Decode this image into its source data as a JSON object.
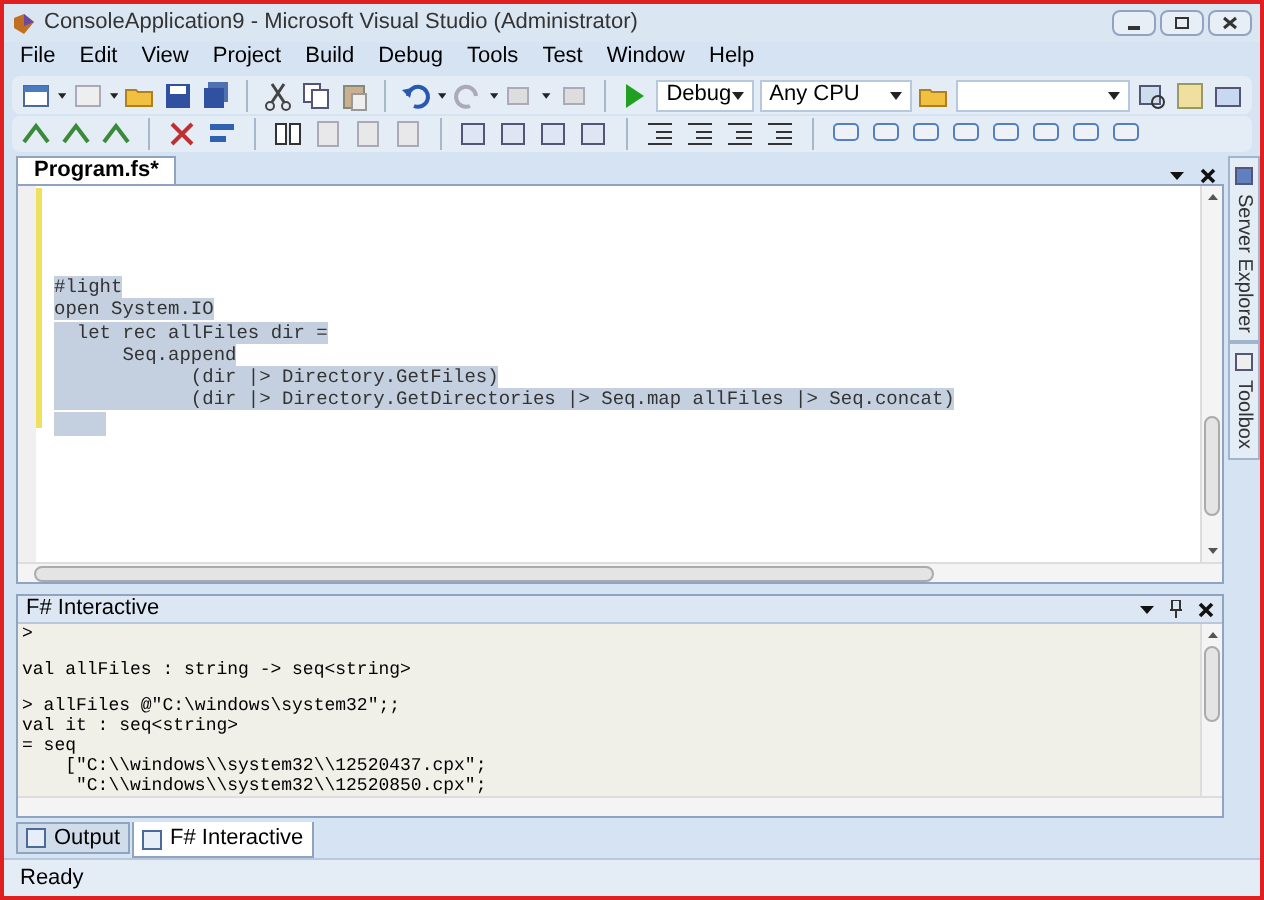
{
  "window": {
    "title": "ConsoleApplication9 - Microsoft Visual Studio (Administrator)"
  },
  "menu": [
    "File",
    "Edit",
    "View",
    "Project",
    "Build",
    "Debug",
    "Tools",
    "Test",
    "Window",
    "Help"
  ],
  "toolbar": {
    "configuration": "Debug",
    "platform": "Any CPU"
  },
  "document_tab": {
    "label": "Program.fs*"
  },
  "editor": {
    "lines": [
      "#light",
      "open System.IO",
      "  let rec allFiles dir =",
      "      Seq.append",
      "            (dir |> Directory.GetFiles)",
      "            (dir |> Directory.GetDirectories |> Seq.map allFiles |> Seq.concat)"
    ],
    "selected": true
  },
  "side_tabs": [
    {
      "label": "Server Explorer"
    },
    {
      "label": "Toolbox"
    }
  ],
  "interactive": {
    "title": "F# Interactive",
    "blocks": [
      [
        ">"
      ],
      [
        "val allFiles : string -> seq<string>"
      ],
      [
        "> allFiles @\"C:\\windows\\system32\";;",
        "val it : seq<string>",
        "= seq",
        "    [\"C:\\\\windows\\\\system32\\\\12520437.cpx\";",
        "     \"C:\\\\windows\\\\system32\\\\12520850.cpx\";"
      ]
    ]
  },
  "bottom_tabs": [
    {
      "label": "Output",
      "selected": false
    },
    {
      "label": "F# Interactive",
      "selected": true
    }
  ],
  "status_bar": {
    "text": "Ready"
  }
}
